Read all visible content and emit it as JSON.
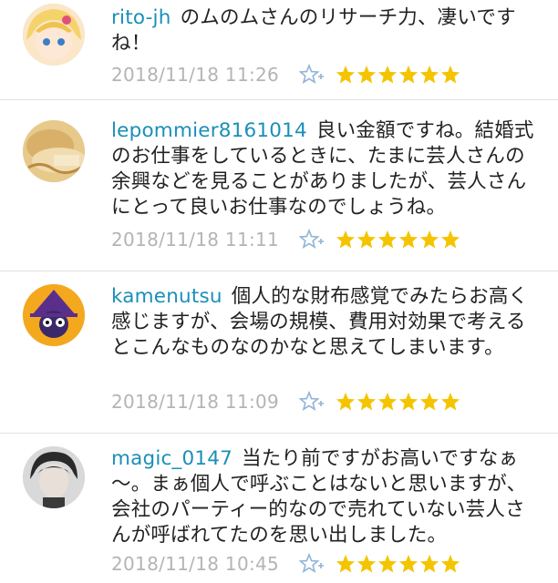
{
  "comments": [
    {
      "username": "rito-jh",
      "text": "のムのムさんのリサーチ力、凄いですね！",
      "timestamp": "2018/11/18 11:26",
      "stars": 6
    },
    {
      "username": "lepommier8161014",
      "text": "良い金額ですね。結婚式のお仕事をしているときに、たまに芸人さんの余興などを見ることがありましたが、芸人さんにとって良いお仕事なのでしょうね。",
      "timestamp": "2018/11/18 11:11",
      "stars": 6
    },
    {
      "username": "kamenutsu",
      "text": "個人的な財布感覚でみたらお高く感じますが、会場の規模、費用対効果で考えるとこんなものなのかなと思えてしまいます。",
      "timestamp": "2018/11/18 11:09",
      "stars": 6
    },
    {
      "username": "magic_0147",
      "text": "当たり前ですがお高いですなぁ～。まぁ個人で呼ぶことはないと思いますが、会社のパーティー的なので売れていない芸人さんが呼ばれてたのを思い出しました。",
      "timestamp": "2018/11/18 10:45",
      "stars": 6
    }
  ],
  "colors": {
    "username": "#1a8fb8",
    "body_text": "#222222",
    "timestamp": "#b4b4b4",
    "star": "#f5c400",
    "add_star": "#8fb4d8"
  },
  "icons": {
    "add_star": "add-star-icon",
    "star": "star-icon"
  }
}
